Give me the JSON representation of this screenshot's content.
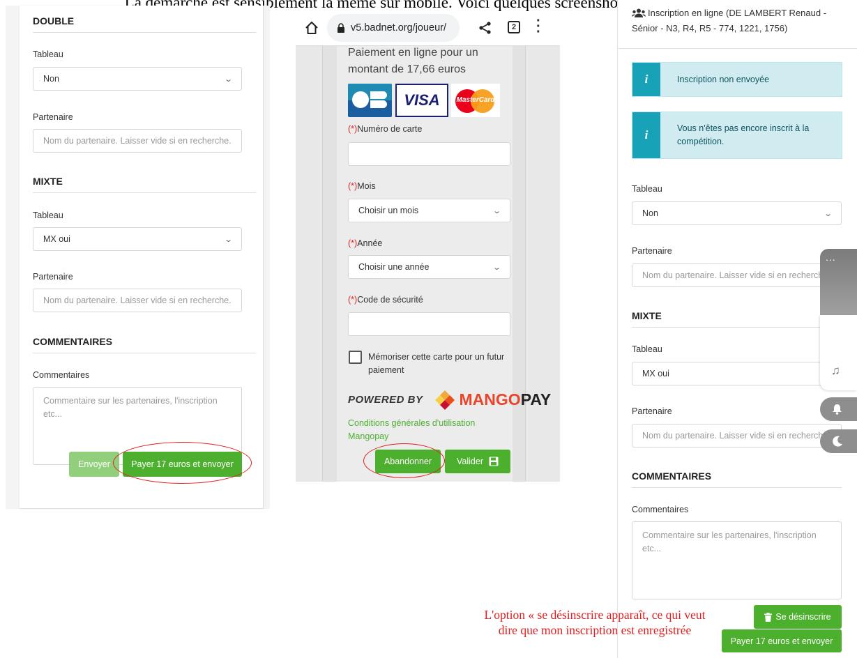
{
  "caption": "La démarche est sensiblement la même sur mobile. Voici quelques screenshots pour vous aider",
  "panel1": {
    "double_title": "DOUBLE",
    "double_tableau_label": "Tableau",
    "double_tableau_value": "Non",
    "double_partner_label": "Partenaire",
    "double_partner_placeholder": "Nom du partenaire. Laisser vide si en recherche.",
    "mixte_title": "MIXTE",
    "mixte_tableau_label": "Tableau",
    "mixte_tableau_value": "MX oui",
    "mixte_partner_label": "Partenaire",
    "mixte_partner_placeholder": "Nom du partenaire. Laisser vide si en recherche.",
    "comments_title": "COMMENTAIRES",
    "comments_label": "Commentaires",
    "comments_placeholder": "Commentaire sur les partenaires, l'inscription etc...",
    "send_label": "Envoyer",
    "pay_label": "Payer 17 euros et envoyer"
  },
  "panel2": {
    "url": "v5.badnet.org/joueur/",
    "tab_count": "2",
    "payment_text": "Paiement en ligne pour un montant de 17,66 euros",
    "card_logos": [
      "CB",
      "VISA",
      "MasterCard"
    ],
    "required_mark": "(*)",
    "card_number_label": "Numéro de carte",
    "month_label": "Mois",
    "month_value": "Choisir un mois",
    "year_label": "Année",
    "year_value": "Choisir une année",
    "cvv_label": "Code de sécurité",
    "remember_label": "Mémoriser cette carte pour un futur paiement",
    "powered_by": "POWERED BY",
    "mangopay_mango": "MANGO",
    "mangopay_pay": "PAY",
    "terms_link": "Conditions générales d'utilisation Mangopay",
    "abandon_label": "Abandonner",
    "validate_label": "Valider"
  },
  "panel3": {
    "header_line1": "Inscription en ligne (DE LAMBERT Renaud -",
    "header_line2": "Sénior - N3, R4, R5 - 774, 1221, 1756)",
    "alert1": "Inscription non envoyée",
    "alert2": "Vous n'êtes pas encore inscrit à la compétition.",
    "tableau_label": "Tableau",
    "tableau_value": "Non",
    "partner_label": "Partenaire",
    "partner_placeholder": "Nom du partenaire. Laisser vide si en recherche.",
    "mixte_title": "MIXTE",
    "mixte_tableau_label": "Tableau",
    "mixte_tableau_value": "MX oui",
    "mixte_partner_label": "Partenaire",
    "mixte_partner_placeholder": "Nom du partenaire. Laisser vide si en recherche.",
    "comments_title": "COMMENTAIRES",
    "comments_label": "Commentaires",
    "comments_placeholder": "Commentaire sur les partenaires, l'inscription etc...",
    "unsubscribe_label": "Se désinscrire",
    "pay_label": "Payer 17 euros et envoyer",
    "float_more": "..."
  },
  "note": "L'option « se désinscrire  apparaît, ce qui veut dire que mon inscription est enregistrée",
  "colors": {
    "green": "#4caf2e",
    "info": "#17a2b8",
    "annotation_red": "#e02020"
  }
}
